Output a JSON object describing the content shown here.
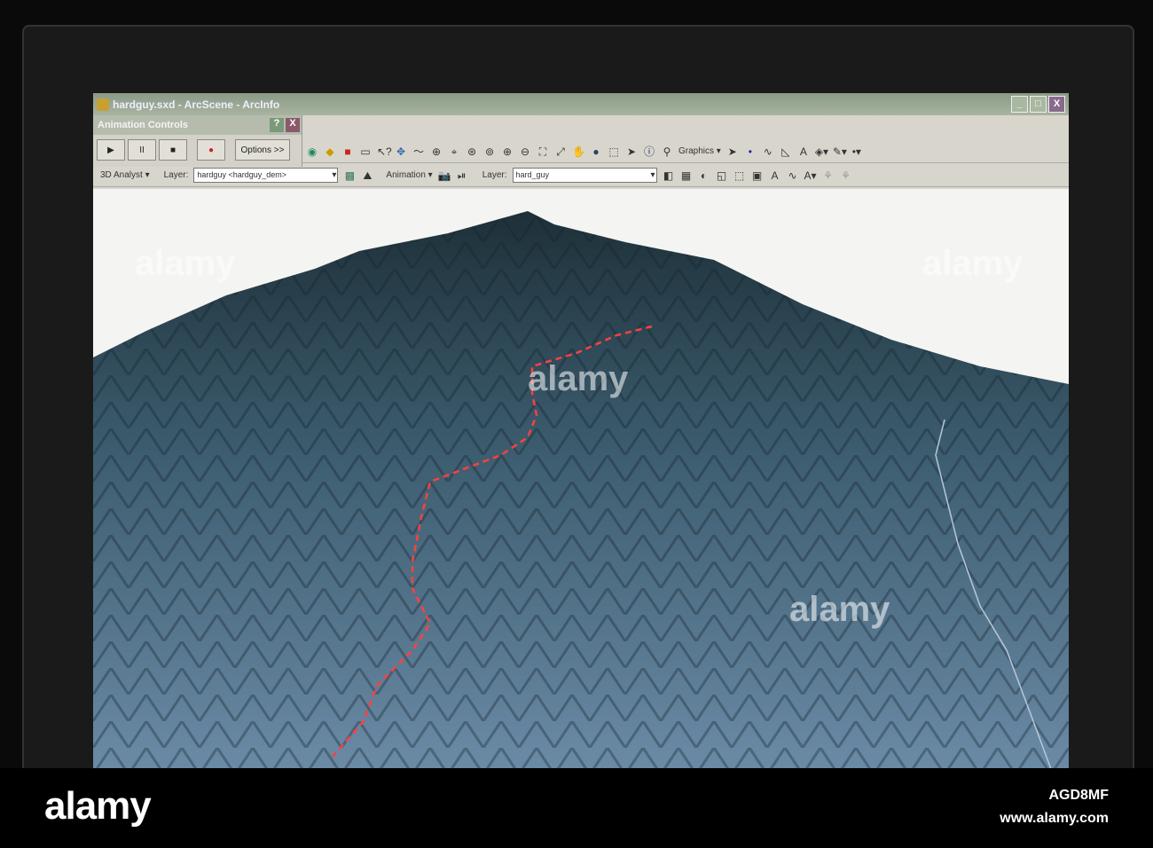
{
  "window": {
    "title": "hardguy.sxd - ArcScene - ArcInfo",
    "min": "_",
    "max": "□",
    "close": "X"
  },
  "animation_controls": {
    "title": "Animation Controls",
    "help": "?",
    "close": "X",
    "play": "▶",
    "pause": "II",
    "stop": "■",
    "record": "●",
    "options": "Options >>"
  },
  "toolbar1": {
    "graphics": "Graphics"
  },
  "toolbar2": {
    "analyst": "3D Analyst",
    "layer_label": "Layer:",
    "layer_value": "hardguy <hardguy_dem>",
    "animation": "Animation",
    "layer2_label": "Layer:",
    "layer2_value": "hard_guy"
  },
  "footer": {
    "logo": "alamy",
    "image_id": "AGD8MF",
    "url": "www.alamy.com"
  },
  "colors": {
    "trail": "#ff4040",
    "terrain": "#4a6a80"
  }
}
